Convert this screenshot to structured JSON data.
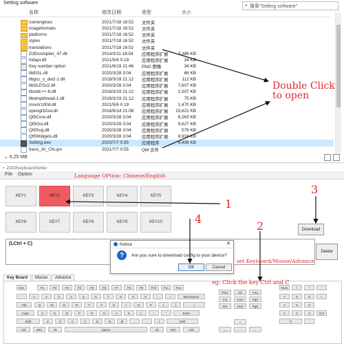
{
  "explorer": {
    "window_title": "Setting software",
    "search_placeholder": "搜索\"Setting software\"",
    "columns": {
      "name": "名称",
      "date": "修改日期",
      "type": "类型",
      "size": "大小"
    },
    "files": [
      {
        "name": "iconengines",
        "date": "2021/7/18 16:52",
        "type": "文件夹",
        "size": "",
        "kind": "folder"
      },
      {
        "name": "imageformats",
        "date": "2021/7/18 16:52",
        "type": "文件夹",
        "size": "",
        "kind": "folder"
      },
      {
        "name": "platforms",
        "date": "2021/7/18 16:52",
        "type": "文件夹",
        "size": "",
        "kind": "folder"
      },
      {
        "name": "styles",
        "date": "2021/7/18 16:52",
        "type": "文件夹",
        "size": "",
        "kind": "folder"
      },
      {
        "name": "translations",
        "date": "2021/7/18 16:52",
        "type": "文件夹",
        "size": "",
        "kind": "folder"
      },
      {
        "name": "D3Dcompiler_47.dll",
        "date": "2014/3/11 18:54",
        "type": "应用程序扩展",
        "size": "3,386 KB",
        "kind": "file"
      },
      {
        "name": "hidapi.dll",
        "date": "2021/5/6 0:19",
        "type": "应用程序扩展",
        "size": "34 KB",
        "kind": "file"
      },
      {
        "name": "Key number option",
        "date": "2021/6/19 21:46",
        "type": "PNG 图像",
        "size": "34 KB",
        "kind": "png"
      },
      {
        "name": "libEGL.dll",
        "date": "2020/3/28 3:04",
        "type": "应用程序扩展",
        "size": "66 KB",
        "kind": "file"
      },
      {
        "name": "libgcc_s_dw2-1.dll",
        "date": "2018/3/19 21:12",
        "type": "应用程序扩展",
        "size": "112 KB",
        "kind": "file"
      },
      {
        "name": "libGLESv2.dll",
        "date": "2020/3/28 3:04",
        "type": "应用程序扩展",
        "size": "7,607 KB",
        "kind": "file"
      },
      {
        "name": "libstdc++-6.dll",
        "date": "2018/3/19 21:12",
        "type": "应用程序扩展",
        "size": "1,507 KB",
        "kind": "file"
      },
      {
        "name": "libwinpthread-1.dll",
        "date": "2018/3/19 21:12",
        "type": "应用程序扩展",
        "size": "75 KB",
        "kind": "file"
      },
      {
        "name": "msvcr100d.dll",
        "date": "2021/5/6 0:19",
        "type": "应用程序扩展",
        "size": "1,470 KB",
        "kind": "file"
      },
      {
        "name": "opengl32sw.dll",
        "date": "2016/6/14 21:08",
        "type": "应用程序扩展",
        "size": "15,621 KB",
        "kind": "file"
      },
      {
        "name": "Qt5Core.dll",
        "date": "2020/3/28 3:04",
        "type": "应用程序扩展",
        "size": "6,263 KB",
        "kind": "file"
      },
      {
        "name": "Qt5Gui.dll",
        "date": "2020/3/28 3:04",
        "type": "应用程序扩展",
        "size": "9,627 KB",
        "kind": "file"
      },
      {
        "name": "Qt5Svg.dll",
        "date": "2020/3/28 3:04",
        "type": "应用程序扩展",
        "size": "576 KB",
        "kind": "file"
      },
      {
        "name": "Qt5Widgets.dll",
        "date": "2020/3/28 3:04",
        "type": "应用程序扩展",
        "size": "8,918 KB",
        "kind": "file"
      },
      {
        "name": "Setting.exe",
        "date": "2020/7/7 0:55",
        "type": "应用程序",
        "size": "6,408 KB",
        "kind": "exe"
      },
      {
        "name": "trans_zh_CN.qm",
        "date": "2021/7/7 0:55",
        "type": "QM 文件",
        "size": "",
        "kind": "file"
      }
    ],
    "status": "6.25 MB"
  },
  "annotations": {
    "double_click": "Double Click",
    "to_open": "to open",
    "language_option": "Language OPtion: Chinese/English",
    "set_modes": "set Keyboard/Mouse/Advance",
    "example": "eg: Click the key Ctrl and C",
    "step1": "1",
    "step2": "2",
    "step3": "3",
    "step4": "4"
  },
  "app": {
    "title": "ZOOKeyboardSetter",
    "menu": [
      "File",
      "Option"
    ],
    "keys_row1": [
      "KEY1",
      "KEY2",
      "KEY3",
      "KEY4",
      "KEY5"
    ],
    "keys_row2": [
      "KEY6",
      "KEY7",
      "KEY8",
      "KEY9",
      "KEY10"
    ],
    "active_key": "KEY2",
    "download": "Download",
    "combo": "(LCtrl + C)",
    "delete": "Delete",
    "tabs": [
      "Key Board",
      "Mouse",
      "Advance"
    ],
    "selected_tab": "Key Board"
  },
  "keyboard": {
    "row1": [
      "Esc",
      "F1",
      "F2",
      "F3",
      "F4",
      "F5",
      "F6",
      "F7",
      "F8",
      "F9",
      "F10",
      "F11",
      "F12"
    ],
    "row2": [
      "`",
      "1",
      "2",
      "3",
      "4",
      "5",
      "6",
      "7",
      "8",
      "9",
      "0",
      "-",
      "=",
      "BackSpace"
    ],
    "row3": [
      "Tab",
      "Q",
      "W",
      "E",
      "R",
      "T",
      "Y",
      "U",
      "I",
      "O",
      "P",
      "[",
      "]",
      "\\"
    ],
    "row4": [
      "Caps",
      "A",
      "S",
      "D",
      "F",
      "G",
      "H",
      "J",
      "K",
      "L",
      ";",
      "'",
      "Enter"
    ],
    "row5": [
      "Shift",
      "Z",
      "X",
      "C",
      "V",
      "B",
      "N",
      "M",
      ",",
      ".",
      "/",
      "Shift"
    ],
    "row6": [
      "Ctrl",
      "Win",
      "Alt",
      "Space",
      "Alt",
      "Win",
      "Ctrl"
    ],
    "nav": [
      "PScr",
      "Scl",
      "Pau",
      "Ins",
      "Hom",
      "PgU",
      "Del",
      "End",
      "PgD"
    ],
    "arrows": [
      "↑",
      "←",
      "↓",
      "→"
    ],
    "numpad_row1": [
      "Num",
      "/",
      "*",
      "-"
    ],
    "numpad_row2": [
      "7",
      "8",
      "9",
      "+"
    ],
    "numpad_row3": [
      "4",
      "5",
      "6"
    ],
    "numpad_row4": [
      "1",
      "2",
      "3",
      "Ent"
    ],
    "numpad_row5": [
      "0",
      "."
    ]
  },
  "dialog": {
    "title": "Notice",
    "message": "Are you sure to download config to your device?",
    "ok": "OK",
    "cancel": "Cancel"
  }
}
